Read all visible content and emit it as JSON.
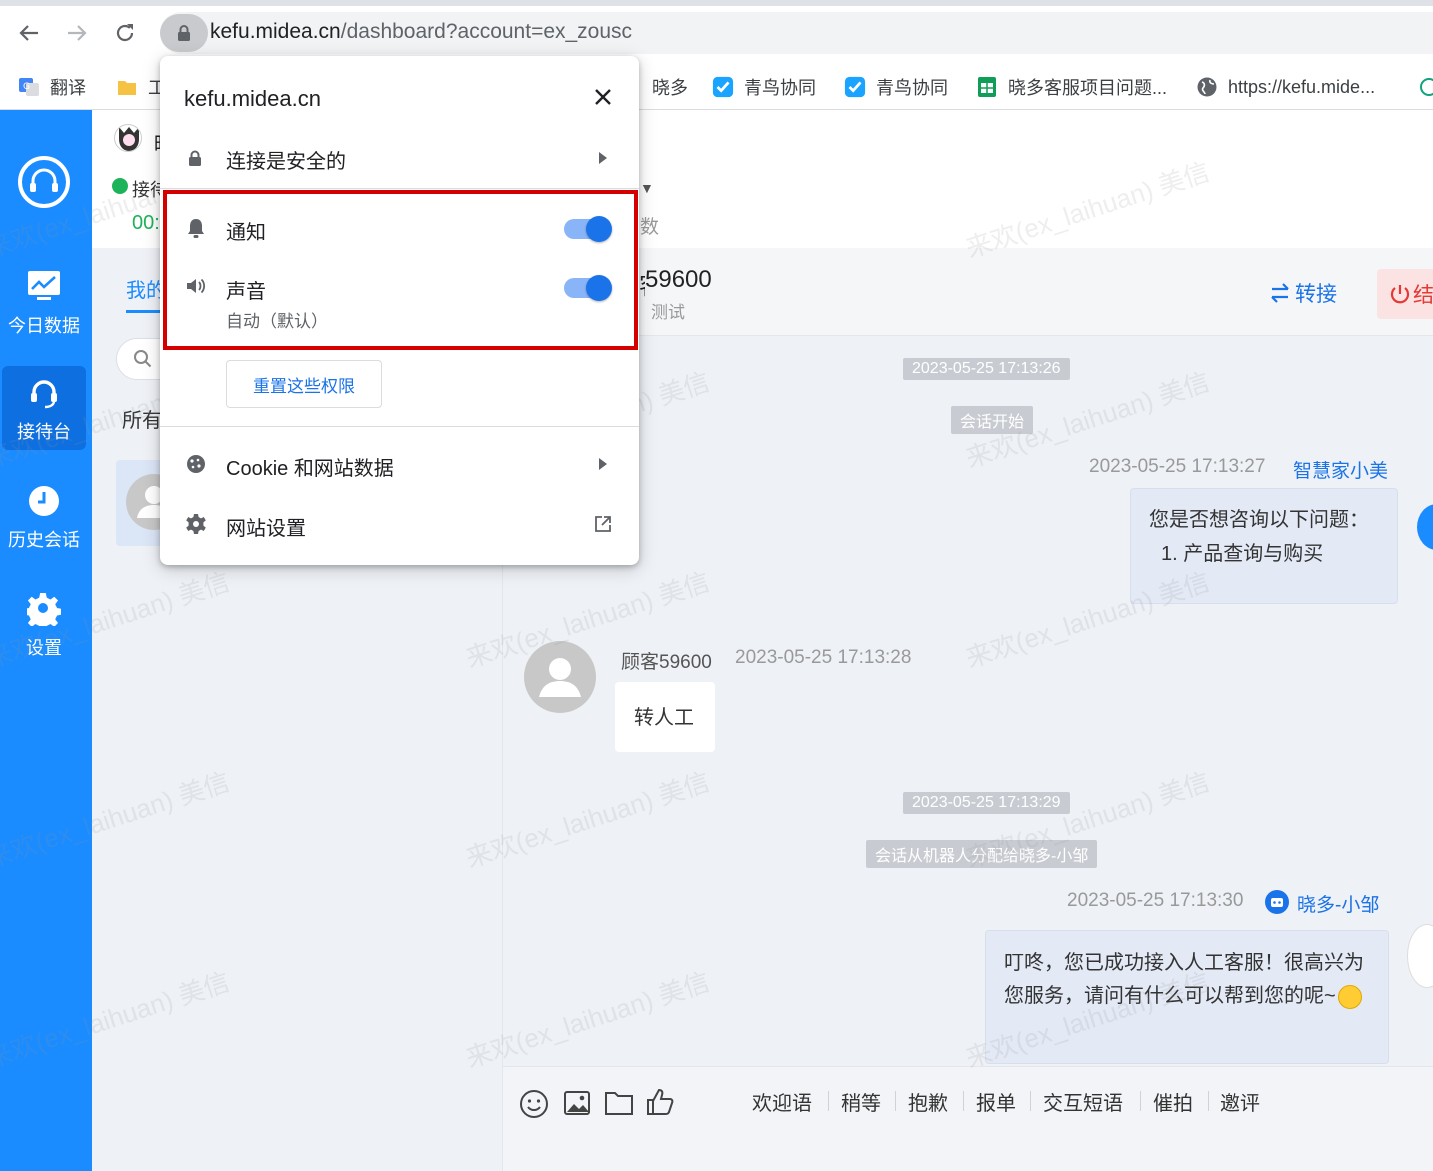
{
  "browser": {
    "url_host": "kefu.midea.cn",
    "url_path": "/dashboard?account=ex_zousc",
    "bookmarks": [
      {
        "label": "翻译",
        "icon": "google-translate-icon"
      },
      {
        "label": "工",
        "icon": "folder-icon"
      },
      {
        "label": "晓多",
        "icon": ""
      },
      {
        "label": "青鸟协同",
        "icon": "check-badge-icon"
      },
      {
        "label": "青鸟协同",
        "icon": "check-badge-icon"
      },
      {
        "label": "晓多客服项目问题...",
        "icon": "sheet-icon"
      },
      {
        "label": "https://kefu.mide...",
        "icon": "globe-icon"
      }
    ]
  },
  "nav": {
    "items": [
      {
        "label": "今日数据",
        "icon": "chart-icon"
      },
      {
        "label": "接待台",
        "icon": "headset-icon",
        "active": true
      },
      {
        "label": "历史会话",
        "icon": "clock-icon"
      },
      {
        "label": "设置",
        "icon": "gear-icon"
      }
    ]
  },
  "status": {
    "name_fragment": "晤",
    "state_label": "接待",
    "timer_fragment": "00:",
    "count_label": "数"
  },
  "list": {
    "tab_label": "我的",
    "filter_label": "所有"
  },
  "chat": {
    "customer_id_fragment": "59600",
    "customer_tag": "测试",
    "transfer_label": "转接",
    "end_label": "结",
    "messages": {
      "t1": "2023-05-25 17:13:26",
      "sys1": "会话开始",
      "bot_meta_time": "2023-05-25 17:13:27",
      "bot_name": "智慧家小美",
      "bot_line1": "您是否想咨询以下问题：",
      "bot_line2": "1. 产品查询与购买",
      "cust_name": "顾客59600",
      "cust_time": "2023-05-25 17:13:28",
      "cust_text": "转人工",
      "t2": "2023-05-25 17:13:29",
      "sys2": "会话从机器人分配给晓多-小邹",
      "agent_time": "2023-05-25 17:13:30",
      "agent_name": "晓多-小邹",
      "agent_text": "叮咚，您已成功接入人工客服！很高兴为您服务，请问有什么可以帮到您的呢~"
    },
    "quick_phrases": [
      "欢迎语",
      "稍等",
      "抱歉",
      "报单",
      "交互短语",
      "催拍",
      "邀评"
    ]
  },
  "popup": {
    "site": "kefu.midea.cn",
    "secure_label": "连接是安全的",
    "notify_label": "通知",
    "notify_on": true,
    "sound_label": "声音",
    "sound_on": true,
    "sound_sub": "自动（默认）",
    "reset_label": "重置这些权限",
    "cookie_label": "Cookie 和网站数据",
    "settings_label": "网站设置"
  },
  "watermark": "来欢(ex_laihuan) 美信",
  "colors": {
    "nav": "#1a8cff",
    "accent": "#1a73e8",
    "highlight": "#d40000"
  }
}
